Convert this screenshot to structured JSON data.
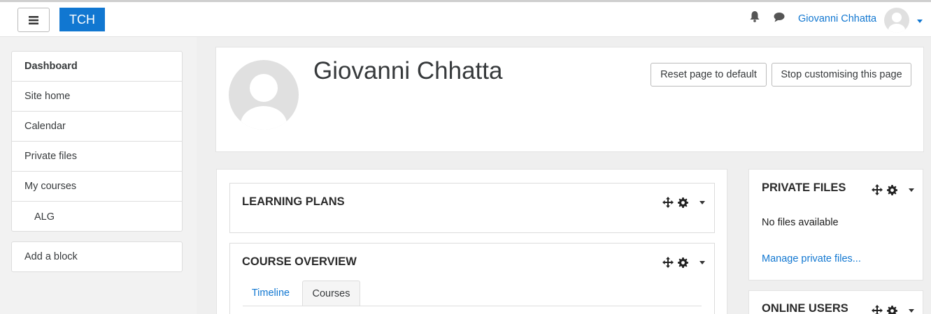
{
  "navbar": {
    "brand": "TCH",
    "user_name": "Giovanni Chhatta",
    "icons": [
      "menu-icon",
      "bell-icon",
      "chat-bubble-icon",
      "user-avatar",
      "caret-down-icon"
    ],
    "accent_color": "#1177d1"
  },
  "sidebar": {
    "items": [
      {
        "label": "Dashboard"
      },
      {
        "label": "Site home"
      },
      {
        "label": "Calendar"
      },
      {
        "label": "Private files"
      },
      {
        "label": "My courses"
      },
      {
        "label": "ALG"
      }
    ],
    "add_block": "Add a block"
  },
  "profile": {
    "name": "Giovanni Chhatta",
    "reset_button": "Reset page to default",
    "stop_button": "Stop customising this page"
  },
  "blocks": {
    "learning_plans": {
      "title": "LEARNING PLANS"
    },
    "course_overview": {
      "title": "COURSE OVERVIEW",
      "tabs": [
        {
          "label": "Timeline"
        },
        {
          "label": "Courses"
        }
      ],
      "active_tab": "Courses"
    },
    "private_files": {
      "title": "PRIVATE FILES",
      "empty_text": "No files available",
      "manage_link": "Manage private files..."
    },
    "online_users": {
      "title": "ONLINE USERS"
    }
  }
}
